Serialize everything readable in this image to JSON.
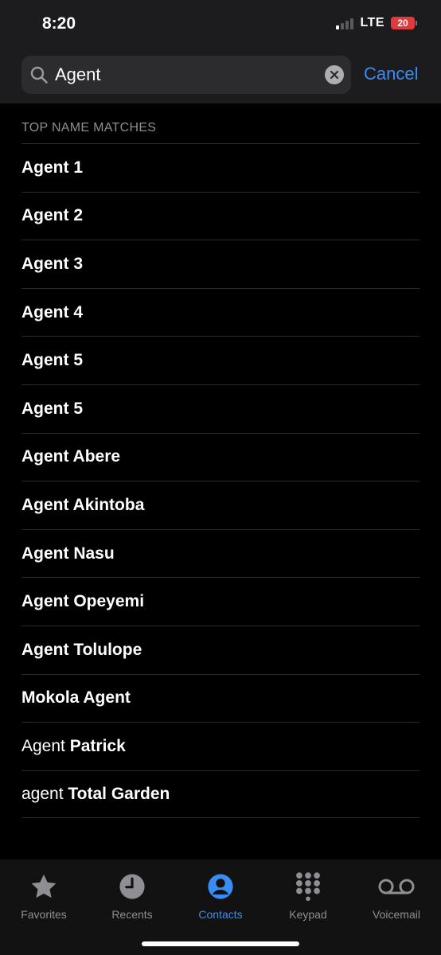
{
  "status": {
    "time": "8:20",
    "network": "LTE",
    "battery": "20"
  },
  "search": {
    "value": "Agent",
    "cancel_label": "Cancel"
  },
  "section_title": "TOP NAME MATCHES",
  "contacts": [
    {
      "first": "Agent 1",
      "last": ""
    },
    {
      "first": "Agent 2",
      "last": ""
    },
    {
      "first": "Agent 3",
      "last": ""
    },
    {
      "first": "Agent 4",
      "last": ""
    },
    {
      "first": "Agent 5",
      "last": ""
    },
    {
      "first": "Agent 5",
      "last": ""
    },
    {
      "first": "Agent Abere",
      "last": ""
    },
    {
      "first": "Agent Akintoba",
      "last": ""
    },
    {
      "first": "Agent Nasu",
      "last": ""
    },
    {
      "first": "Agent Opeyemi",
      "last": ""
    },
    {
      "first": "Agent Tolulope",
      "last": ""
    },
    {
      "first": "Mokola Agent",
      "last": ""
    },
    {
      "first": "Agent",
      "last": "Patrick"
    },
    {
      "first": "agent",
      "last": "Total Garden"
    }
  ],
  "tabs": [
    {
      "label": "Favorites",
      "icon": "star-icon"
    },
    {
      "label": "Recents",
      "icon": "clock-icon"
    },
    {
      "label": "Contacts",
      "icon": "person-circle-icon"
    },
    {
      "label": "Keypad",
      "icon": "keypad-icon"
    },
    {
      "label": "Voicemail",
      "icon": "voicemail-icon"
    }
  ],
  "colors": {
    "accent": "#3a8cf5",
    "tab_inactive": "#8e8e93",
    "battery_low": "#e0393e"
  }
}
